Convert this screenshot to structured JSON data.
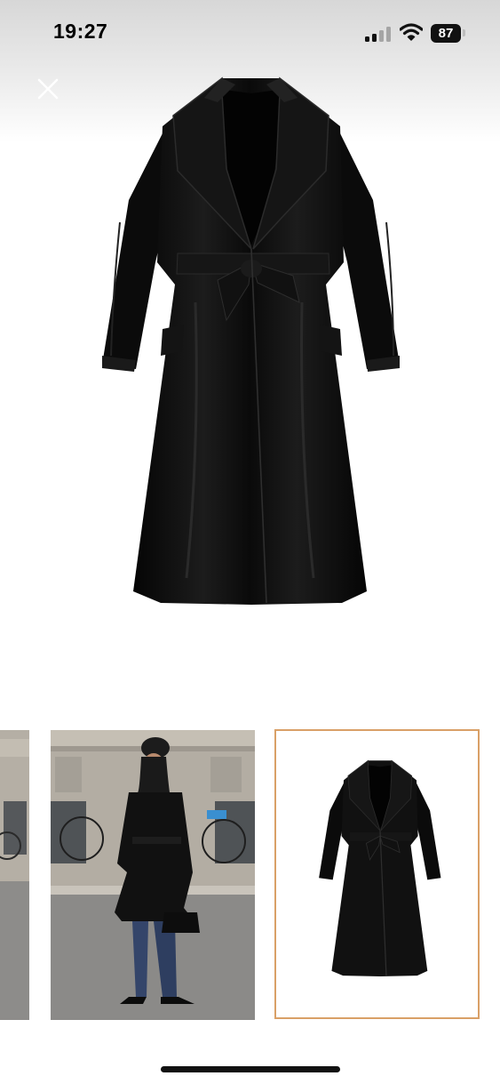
{
  "status_bar": {
    "time": "19:27",
    "battery_level": "87",
    "signal_bars_active": 2,
    "signal_bars_total": 4,
    "icons": [
      "signal-icon",
      "wifi-icon",
      "battery-icon"
    ]
  },
  "viewer": {
    "close_icon": "close-icon",
    "main_image": "black-leather-trench-coat-product-photo",
    "thumbnails": [
      {
        "image": "street-photo-partial",
        "selected": false
      },
      {
        "image": "model-wearing-coat-street-photo",
        "selected": false
      },
      {
        "image": "coat-product-photo",
        "selected": true
      }
    ],
    "selected_index": 2
  },
  "colors": {
    "selected_border": "#d9a067",
    "coat": "#0e0e0e",
    "status_gradient_top": "#d7d7d7"
  }
}
